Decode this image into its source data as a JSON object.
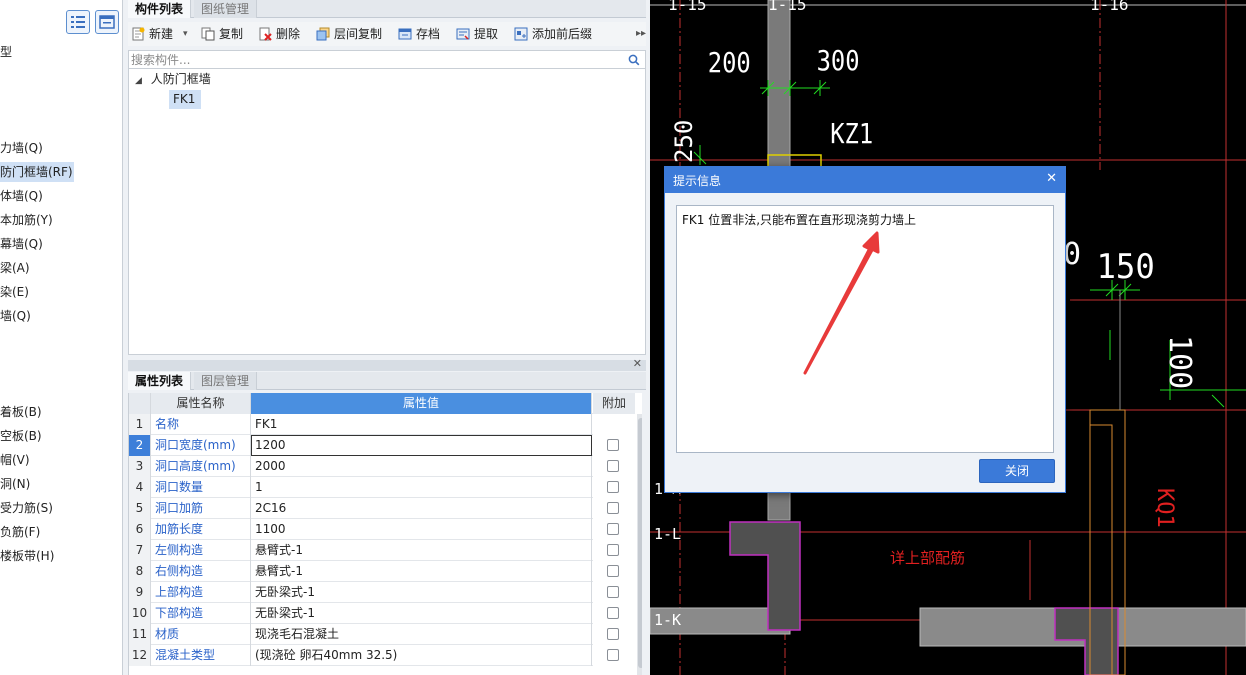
{
  "left_nav": {
    "items": [
      {
        "label": "型",
        "selected": false
      },
      {
        "label": "力墙(Q)",
        "selected": false
      },
      {
        "label": "防门框墙(RF)",
        "selected": true
      },
      {
        "label": "体墙(Q)",
        "selected": false
      },
      {
        "label": "本加筋(Y)",
        "selected": false
      },
      {
        "label": "幕墙(Q)",
        "selected": false
      },
      {
        "label": "梁(A)",
        "selected": false
      },
      {
        "label": "染(E)",
        "selected": false
      },
      {
        "label": "墙(Q)",
        "selected": false
      },
      {
        "label": "着板(B)",
        "selected": false
      },
      {
        "label": "空板(B)",
        "selected": false
      },
      {
        "label": "帽(V)",
        "selected": false
      },
      {
        "label": "洞(N)",
        "selected": false
      },
      {
        "label": "受力筋(S)",
        "selected": false
      },
      {
        "label": "负筋(F)",
        "selected": false
      },
      {
        "label": "楼板带(H)",
        "selected": false
      }
    ]
  },
  "component_panel": {
    "tabs": [
      {
        "label": "构件列表",
        "active": true
      },
      {
        "label": "图纸管理",
        "active": false
      }
    ],
    "toolbar": {
      "new": "新建",
      "copy": "复制",
      "delete": "删除",
      "floor_copy": "层间复制",
      "save": "存档",
      "extract": "提取",
      "prefix_suffix": "添加前后缀"
    },
    "search_placeholder": "搜索构件...",
    "tree": {
      "parent": "人防门框墙",
      "child": "FK1"
    }
  },
  "property_panel": {
    "tabs": [
      {
        "label": "属性列表",
        "active": true
      },
      {
        "label": "图层管理",
        "active": false
      }
    ],
    "columns": {
      "name": "属性名称",
      "value": "属性值",
      "extra": "附加"
    },
    "rows": [
      {
        "num": "1",
        "name": "名称",
        "value": "FK1",
        "has_check": false
      },
      {
        "num": "2",
        "name": "洞口宽度(mm)",
        "value": "1200",
        "has_check": true
      },
      {
        "num": "3",
        "name": "洞口高度(mm)",
        "value": "2000",
        "has_check": true
      },
      {
        "num": "4",
        "name": "洞口数量",
        "value": "1",
        "has_check": true
      },
      {
        "num": "5",
        "name": "洞口加筋",
        "value": "2C16",
        "has_check": true
      },
      {
        "num": "6",
        "name": "加筋长度",
        "value": "1100",
        "has_check": true
      },
      {
        "num": "7",
        "name": "左侧构造",
        "value": "悬臂式-1",
        "has_check": true
      },
      {
        "num": "8",
        "name": "右侧构造",
        "value": "悬臂式-1",
        "has_check": true
      },
      {
        "num": "9",
        "name": "上部构造",
        "value": "无卧梁式-1",
        "has_check": true
      },
      {
        "num": "10",
        "name": "下部构造",
        "value": "无卧梁式-1",
        "has_check": true
      },
      {
        "num": "11",
        "name": "材质",
        "value": "现浇毛石混凝土",
        "has_check": true
      },
      {
        "num": "12",
        "name": "混凝土类型",
        "value": "(现浇砼 卵石40mm 32.5)",
        "has_check": true
      }
    ],
    "selected_row": 2
  },
  "cad": {
    "labels": {
      "axis_1_15a": "1-15",
      "axis_1_15b": "1-15",
      "axis_1_16": "1-16",
      "dim_200": "200",
      "dim_300": "300",
      "kz1": "KZ1",
      "dim_250": "250",
      "dim_0": "0",
      "dim_150": "150",
      "dim_100": "100",
      "axis_1m": "1-M",
      "axis_1l": "1-L",
      "axis_1k": "1-K",
      "note": "详上部配筋",
      "kq1": "KQ1"
    }
  },
  "dialog": {
    "title": "提示信息",
    "message": "FK1 位置非法,只能布置在直形现浇剪力墙上",
    "close_label": "关闭"
  },
  "colors": {
    "accent": "#3b7ad9",
    "link_blue": "#2a62c9",
    "cad_bg": "#000000",
    "cad_red": "#e02020",
    "cad_green": "#22dd22",
    "annotation": "#e83a3a"
  }
}
